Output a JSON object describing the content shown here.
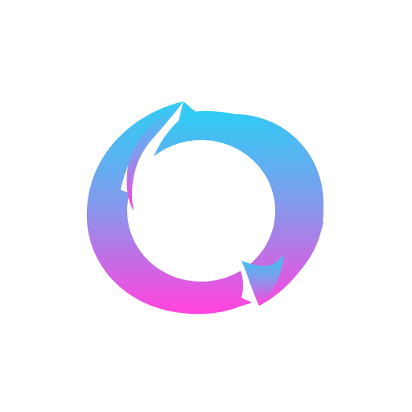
{
  "logo": {
    "icon": "swirl-ring-logo-icon",
    "gradient_top": "#2ecdf5",
    "gradient_mid": "#8a95ec",
    "gradient_bottom": "#ff44dd",
    "background": "#ffffff"
  }
}
